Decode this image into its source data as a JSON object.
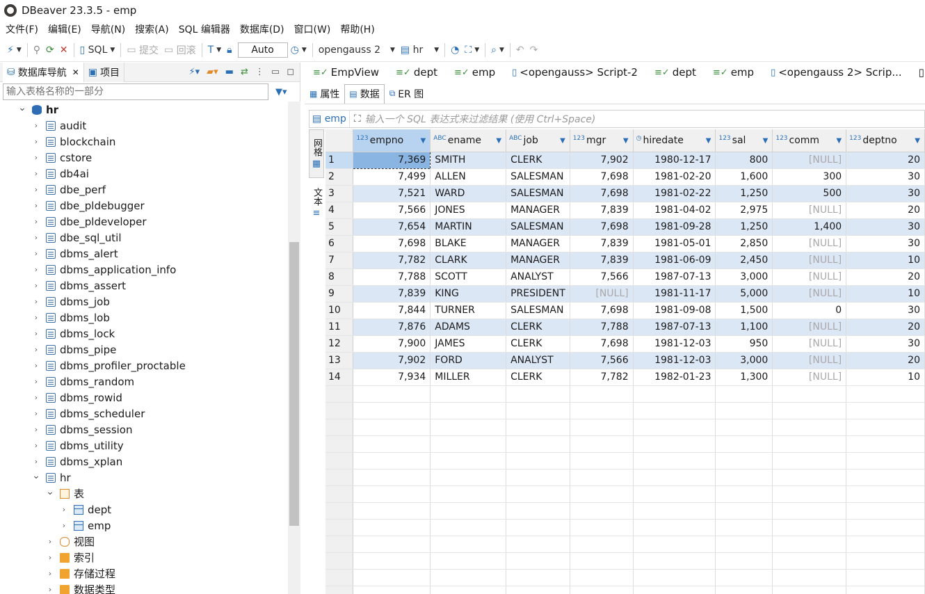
{
  "window": {
    "title": "DBeaver 23.3.5 - emp"
  },
  "menu": [
    "文件(F)",
    "编辑(E)",
    "导航(N)",
    "搜索(A)",
    "SQL 编辑器",
    "数据库(D)",
    "窗口(W)",
    "帮助(H)"
  ],
  "toolbar": {
    "sql_label": "SQL",
    "commit_label": "提交",
    "rollback_label": "回滚",
    "mode_value": "Auto",
    "datasource": "opengauss 2",
    "schema": "hr"
  },
  "left_panel": {
    "tab_navigator": "数据库导航",
    "tab_projects": "项目",
    "filter_placeholder": "输入表格名称的一部分",
    "tree": [
      {
        "label": "hr",
        "level": 1,
        "icon": "database-icon",
        "expanded": true,
        "bold": true
      },
      {
        "label": "audit",
        "level": 2,
        "icon": "schema-icon"
      },
      {
        "label": "blockchain",
        "level": 2,
        "icon": "schema-icon"
      },
      {
        "label": "cstore",
        "level": 2,
        "icon": "schema-icon"
      },
      {
        "label": "db4ai",
        "level": 2,
        "icon": "schema-icon"
      },
      {
        "label": "dbe_perf",
        "level": 2,
        "icon": "schema-icon"
      },
      {
        "label": "dbe_pldebugger",
        "level": 2,
        "icon": "schema-icon"
      },
      {
        "label": "dbe_pldeveloper",
        "level": 2,
        "icon": "schema-icon"
      },
      {
        "label": "dbe_sql_util",
        "level": 2,
        "icon": "schema-icon"
      },
      {
        "label": "dbms_alert",
        "level": 2,
        "icon": "schema-icon"
      },
      {
        "label": "dbms_application_info",
        "level": 2,
        "icon": "schema-icon"
      },
      {
        "label": "dbms_assert",
        "level": 2,
        "icon": "schema-icon"
      },
      {
        "label": "dbms_job",
        "level": 2,
        "icon": "schema-icon"
      },
      {
        "label": "dbms_lob",
        "level": 2,
        "icon": "schema-icon"
      },
      {
        "label": "dbms_lock",
        "level": 2,
        "icon": "schema-icon"
      },
      {
        "label": "dbms_pipe",
        "level": 2,
        "icon": "schema-icon"
      },
      {
        "label": "dbms_profiler_proctable",
        "level": 2,
        "icon": "schema-icon"
      },
      {
        "label": "dbms_random",
        "level": 2,
        "icon": "schema-icon"
      },
      {
        "label": "dbms_rowid",
        "level": 2,
        "icon": "schema-icon"
      },
      {
        "label": "dbms_scheduler",
        "level": 2,
        "icon": "schema-icon"
      },
      {
        "label": "dbms_session",
        "level": 2,
        "icon": "schema-icon"
      },
      {
        "label": "dbms_utility",
        "level": 2,
        "icon": "schema-icon"
      },
      {
        "label": "dbms_xplan",
        "level": 2,
        "icon": "schema-icon"
      },
      {
        "label": "hr",
        "level": 2,
        "icon": "schema-icon",
        "expanded": true
      },
      {
        "label": "表",
        "level": 3,
        "icon": "tables-folder-icon",
        "expanded": true
      },
      {
        "label": "dept",
        "level": 4,
        "icon": "table-icon"
      },
      {
        "label": "emp",
        "level": 4,
        "icon": "table-icon"
      },
      {
        "label": "视图",
        "level": 3,
        "icon": "views-folder-icon"
      },
      {
        "label": "索引",
        "level": 3,
        "icon": "folder-icon"
      },
      {
        "label": "存储过程",
        "level": 3,
        "icon": "folder-icon"
      },
      {
        "label": "数据类型",
        "level": 3,
        "icon": "folder-icon"
      }
    ]
  },
  "editor_tabs": [
    {
      "label": "EmpView",
      "icon": "view-edit-icon"
    },
    {
      "label": "dept",
      "icon": "table-edit-icon"
    },
    {
      "label": "emp",
      "icon": "table-edit-icon"
    },
    {
      "label": "<opengauss> Script-2",
      "icon": "script-icon"
    },
    {
      "label": "dept",
      "icon": "table-edit-icon"
    },
    {
      "label": "emp",
      "icon": "table-edit-icon"
    },
    {
      "label": "<opengauss 2> Scrip...",
      "icon": "script-icon"
    }
  ],
  "sub_tabs": [
    "属性",
    "数据",
    "ER 图"
  ],
  "filter_bar": {
    "entity": "emp",
    "placeholder": "输入一个 SQL 表达式来过滤结果 (使用 Ctrl+Space)"
  },
  "side_buttons": {
    "grid": "网格",
    "text": "文本"
  },
  "grid": {
    "columns": [
      {
        "name": "empno",
        "type": "123"
      },
      {
        "name": "ename",
        "type": "ABC"
      },
      {
        "name": "job",
        "type": "ABC"
      },
      {
        "name": "mgr",
        "type": "123"
      },
      {
        "name": "hiredate",
        "type": "clock"
      },
      {
        "name": "sal",
        "type": "123"
      },
      {
        "name": "comm",
        "type": "123"
      },
      {
        "name": "deptno",
        "type": "123"
      }
    ],
    "null_text": "[NULL]",
    "rows": [
      [
        "1",
        "7,369",
        "SMITH",
        "CLERK",
        "7,902",
        "1980-12-17",
        "800",
        "[NULL]",
        "20"
      ],
      [
        "2",
        "7,499",
        "ALLEN",
        "SALESMAN",
        "7,698",
        "1981-02-20",
        "1,600",
        "300",
        "30"
      ],
      [
        "3",
        "7,521",
        "WARD",
        "SALESMAN",
        "7,698",
        "1981-02-22",
        "1,250",
        "500",
        "30"
      ],
      [
        "4",
        "7,566",
        "JONES",
        "MANAGER",
        "7,839",
        "1981-04-02",
        "2,975",
        "[NULL]",
        "20"
      ],
      [
        "5",
        "7,654",
        "MARTIN",
        "SALESMAN",
        "7,698",
        "1981-09-28",
        "1,250",
        "1,400",
        "30"
      ],
      [
        "6",
        "7,698",
        "BLAKE",
        "MANAGER",
        "7,839",
        "1981-05-01",
        "2,850",
        "[NULL]",
        "30"
      ],
      [
        "7",
        "7,782",
        "CLARK",
        "MANAGER",
        "7,839",
        "1981-06-09",
        "2,450",
        "[NULL]",
        "10"
      ],
      [
        "8",
        "7,788",
        "SCOTT",
        "ANALYST",
        "7,566",
        "1987-07-13",
        "3,000",
        "[NULL]",
        "20"
      ],
      [
        "9",
        "7,839",
        "KING",
        "PRESIDENT",
        "[NULL]",
        "1981-11-17",
        "5,000",
        "[NULL]",
        "10"
      ],
      [
        "10",
        "7,844",
        "TURNER",
        "SALESMAN",
        "7,698",
        "1981-09-08",
        "1,500",
        "0",
        "30"
      ],
      [
        "11",
        "7,876",
        "ADAMS",
        "CLERK",
        "7,788",
        "1987-07-13",
        "1,100",
        "[NULL]",
        "20"
      ],
      [
        "12",
        "7,900",
        "JAMES",
        "CLERK",
        "7,698",
        "1981-12-03",
        "950",
        "[NULL]",
        "30"
      ],
      [
        "13",
        "7,902",
        "FORD",
        "ANALYST",
        "7,566",
        "1981-12-03",
        "3,000",
        "[NULL]",
        "20"
      ],
      [
        "14",
        "7,934",
        "MILLER",
        "CLERK",
        "7,782",
        "1982-01-23",
        "1,300",
        "[NULL]",
        "10"
      ]
    ],
    "empty_rows": 13
  }
}
